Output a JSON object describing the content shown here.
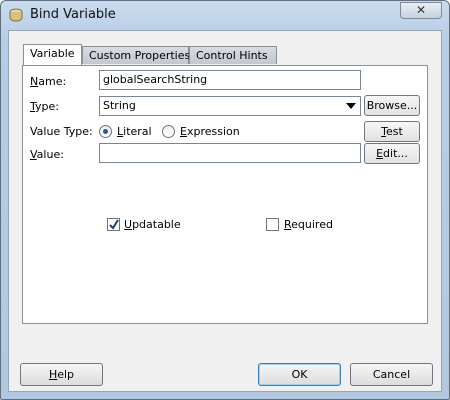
{
  "window": {
    "title": "Bind Variable",
    "close_glyph": "✕"
  },
  "tabs": [
    {
      "label": "Variable",
      "active": true
    },
    {
      "label": "Custom Properties",
      "active": false
    },
    {
      "label": "Control Hints",
      "active": false
    }
  ],
  "form": {
    "name_label": "Name:",
    "name_value": "globalSearchString",
    "type_label": "Type:",
    "type_value": "String",
    "browse_label": "Browse...",
    "value_type_label": "Value Type:",
    "literal_label": "Literal",
    "expression_label": "Expression",
    "value_type_selected": "Literal",
    "test_label": "Test",
    "value_label": "Value:",
    "value_value": "",
    "edit_label": "Edit...",
    "updatable_label": "Updatable",
    "updatable_checked": true,
    "required_label": "Required",
    "required_checked": false
  },
  "footer": {
    "help_label": "Help",
    "ok_label": "OK",
    "cancel_label": "Cancel"
  },
  "icons": {
    "title_icon": "bind-variable-icon",
    "close_icon": "close-icon",
    "dropdown_icon": "chevron-down-icon",
    "check_icon": "checkmark-icon"
  },
  "colors": {
    "title_bar": "#b7cde6",
    "panel_bg": "#f0f0f0",
    "radio_selected": "#2a5a9a",
    "default_button_border": "#3c7fb1"
  }
}
